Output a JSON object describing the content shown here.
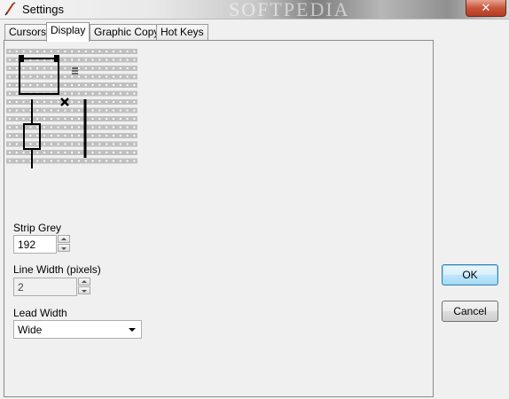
{
  "window": {
    "title": "Settings",
    "watermark": "SOFTPEDIA",
    "close_label": "✕"
  },
  "tabs": [
    {
      "label": "Cursors",
      "active": false
    },
    {
      "label": "Display",
      "active": true
    },
    {
      "label": "Graphic Copy",
      "active": false
    },
    {
      "label": "Hot Keys",
      "active": false
    }
  ],
  "display": {
    "strip_grey": {
      "label": "Strip Grey",
      "value": "192"
    },
    "line_width": {
      "label": "Line Width (pixels)",
      "value": "2"
    },
    "lead_width": {
      "label": "Lead Width",
      "selected": "Wide"
    }
  },
  "buttons": {
    "ok": "OK",
    "cancel": "Cancel"
  },
  "colors": {
    "strip_grey": "#c0c0c0",
    "panel_bg": "#f0f0f0",
    "accent_border": "#3c7fb1"
  }
}
